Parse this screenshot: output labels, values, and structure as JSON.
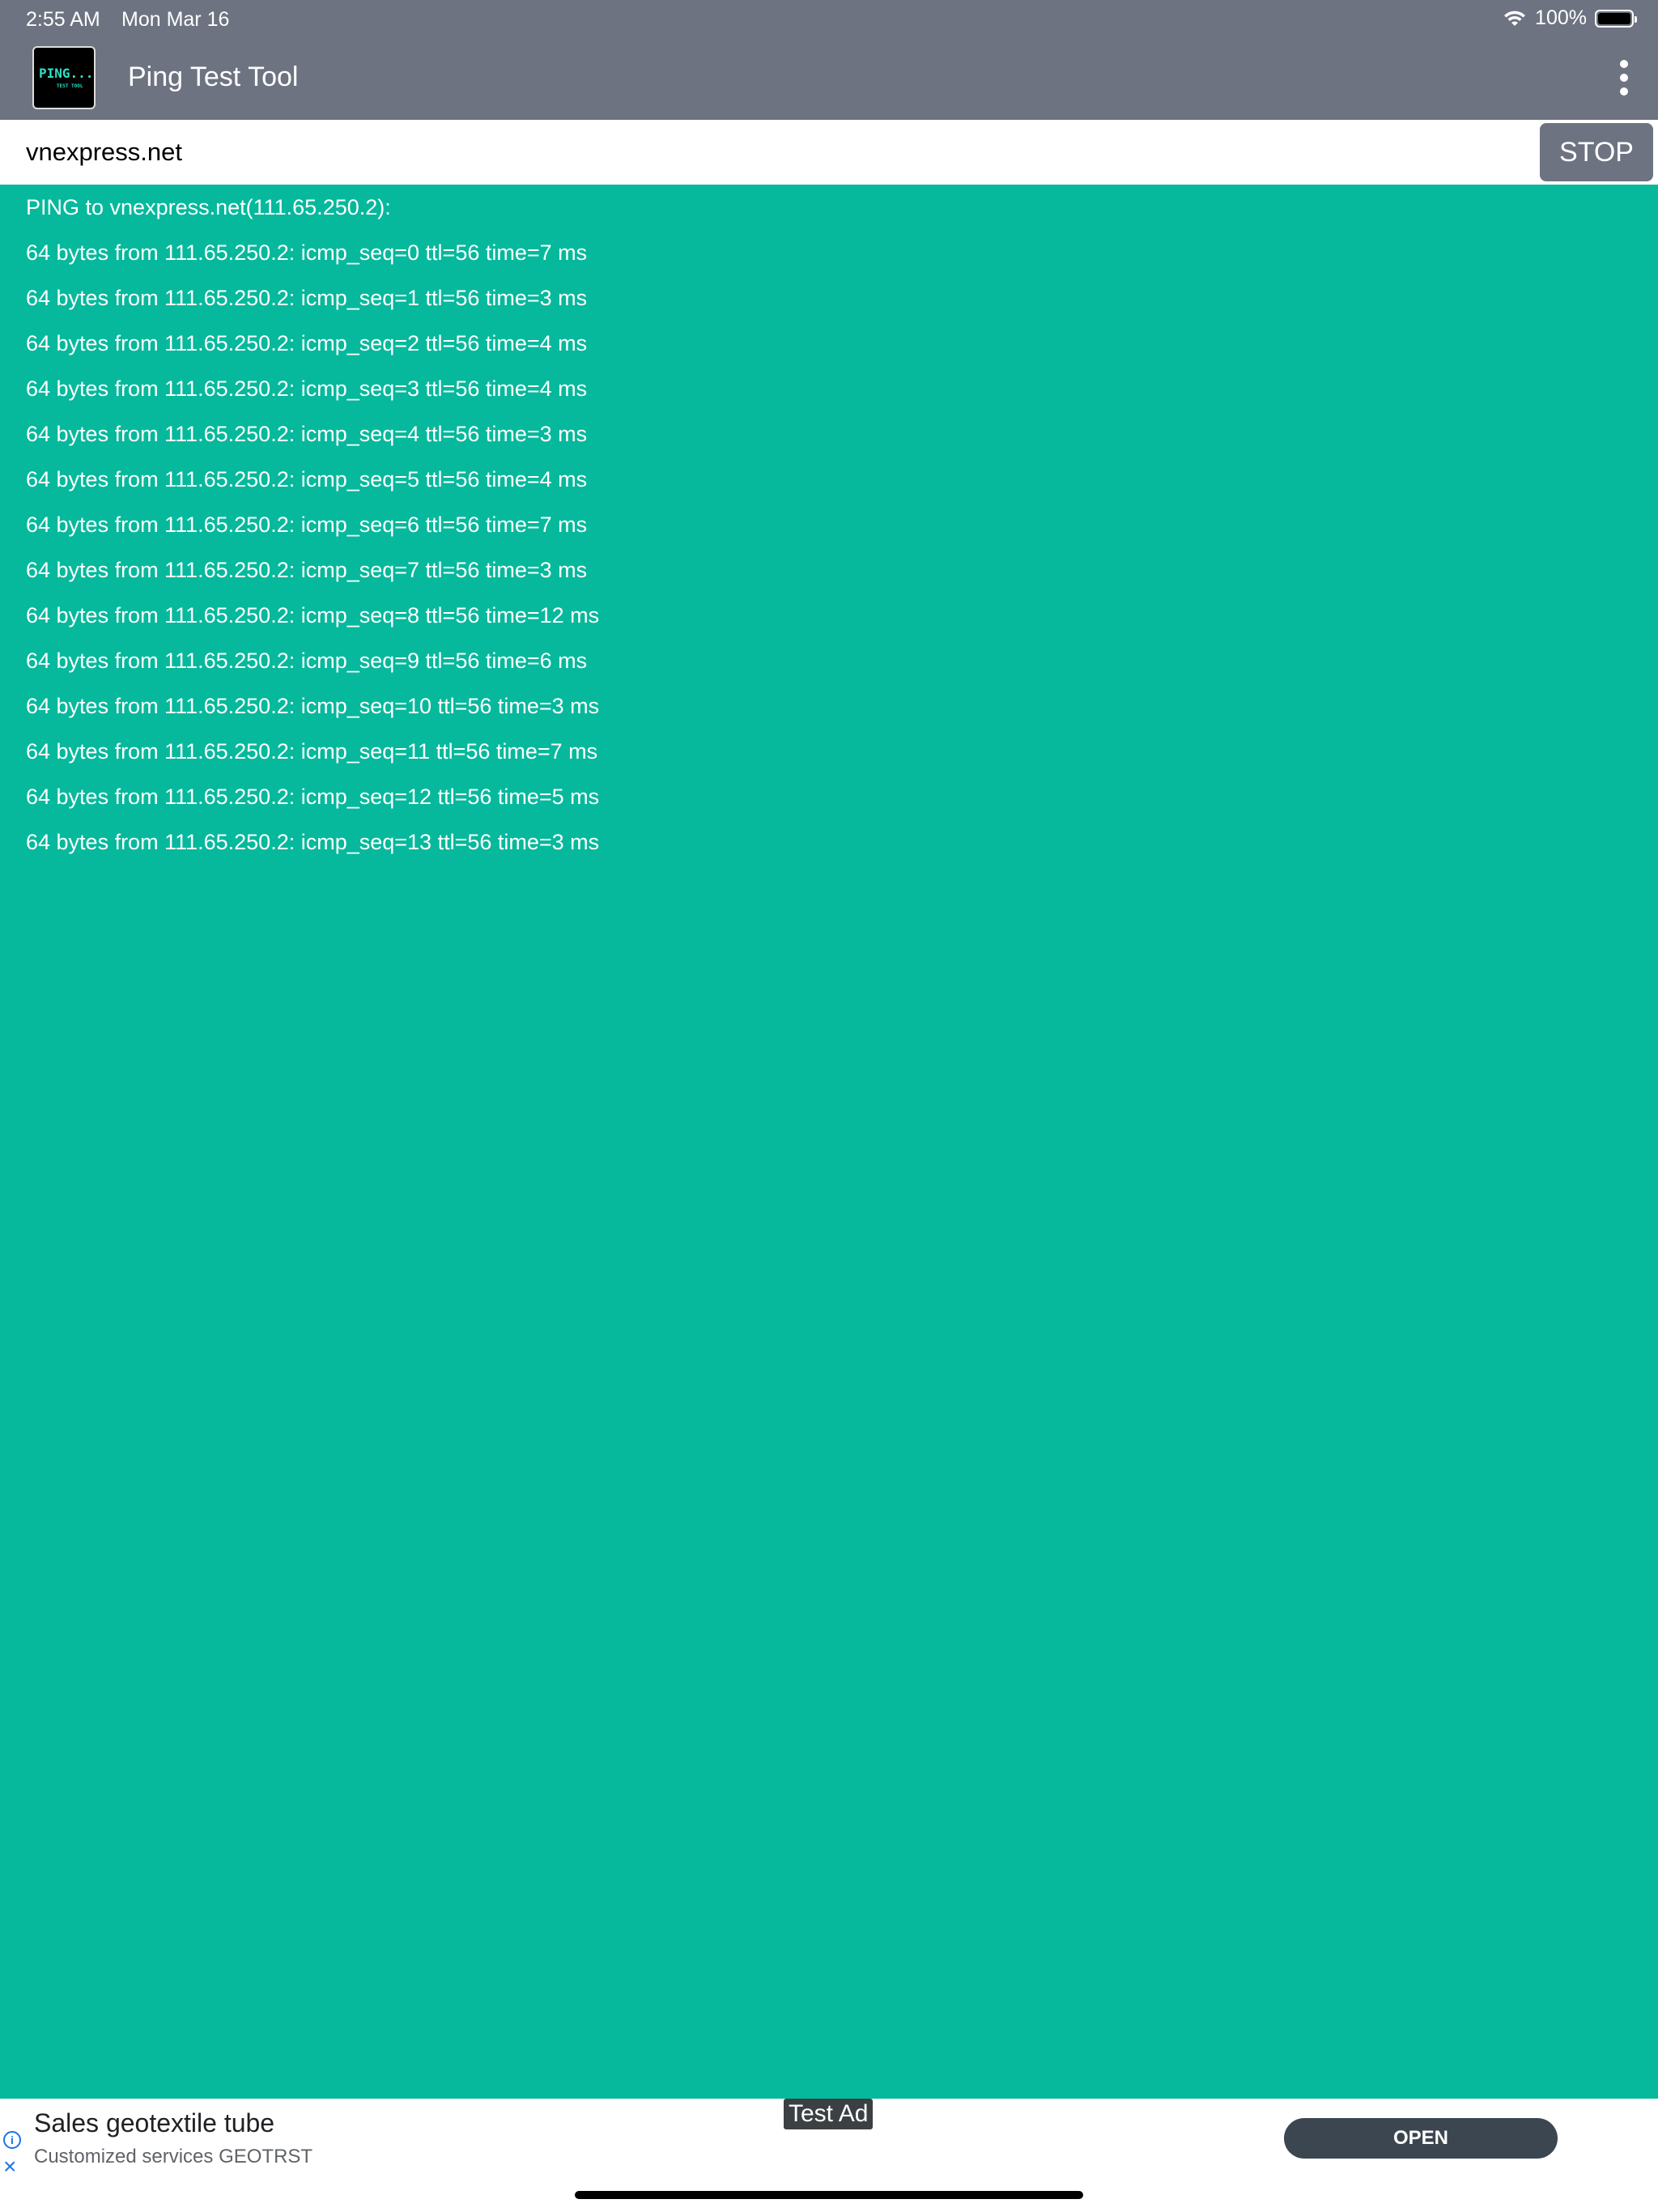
{
  "status_bar": {
    "time": "2:55 AM",
    "date": "Mon Mar 16",
    "battery": "100%"
  },
  "app": {
    "title": "Ping Test Tool",
    "logo_text": "PING...",
    "logo_subtext": "TEST TOOL"
  },
  "host": {
    "value": "vnexpress.net",
    "stop_label": "STOP"
  },
  "output": {
    "lines": [
      "PING to vnexpress.net(111.65.250.2):",
      "64 bytes from 111.65.250.2: icmp_seq=0 ttl=56 time=7 ms",
      "64 bytes from 111.65.250.2: icmp_seq=1 ttl=56 time=3 ms",
      "64 bytes from 111.65.250.2: icmp_seq=2 ttl=56 time=4 ms",
      "64 bytes from 111.65.250.2: icmp_seq=3 ttl=56 time=4 ms",
      "64 bytes from 111.65.250.2: icmp_seq=4 ttl=56 time=3 ms",
      "64 bytes from 111.65.250.2: icmp_seq=5 ttl=56 time=4 ms",
      "64 bytes from 111.65.250.2: icmp_seq=6 ttl=56 time=7 ms",
      "64 bytes from 111.65.250.2: icmp_seq=7 ttl=56 time=3 ms",
      "64 bytes from 111.65.250.2: icmp_seq=8 ttl=56 time=12 ms",
      "64 bytes from 111.65.250.2: icmp_seq=9 ttl=56 time=6 ms",
      "64 bytes from 111.65.250.2: icmp_seq=10 ttl=56 time=3 ms",
      "64 bytes from 111.65.250.2: icmp_seq=11 ttl=56 time=7 ms",
      "64 bytes from 111.65.250.2: icmp_seq=12 ttl=56 time=5 ms",
      "64 bytes from 111.65.250.2: icmp_seq=13 ttl=56 time=3 ms"
    ]
  },
  "ad": {
    "badge": "Test Ad",
    "title": "Sales geotextile tube",
    "subtitle": "Customized services GEOTRST",
    "cta": "OPEN"
  },
  "colors": {
    "background": "#06b99c",
    "toolbar": "#6d7381",
    "cta": "#3c4650"
  }
}
